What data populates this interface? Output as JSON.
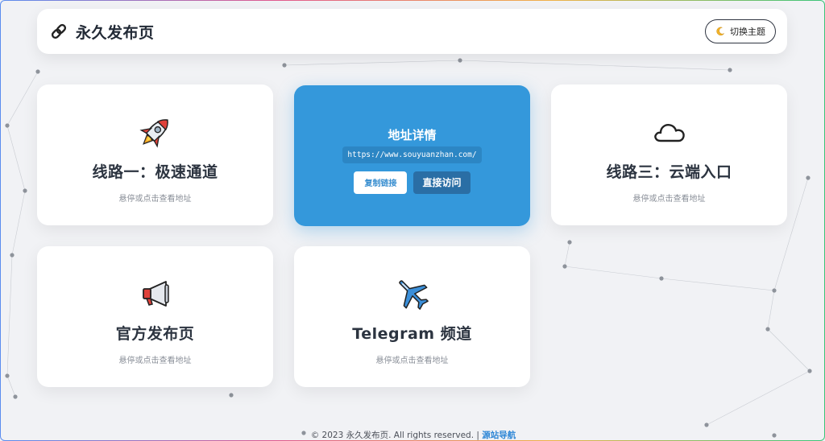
{
  "header": {
    "title": "永久发布页",
    "theme_button": "切换主题",
    "brand_icon": "link-icon",
    "theme_icon": "moon-icon"
  },
  "cards": [
    {
      "title": "线路一：极速通道",
      "hint": "悬停或点击查看地址",
      "icon": "rocket-icon"
    },
    {
      "detail_title": "地址详情",
      "url": "https://www.souyuanzhan.com/",
      "copy_label": "复制链接",
      "visit_label": "直接访问"
    },
    {
      "title": "线路三：云端入口",
      "hint": "悬停或点击查看地址",
      "icon": "cloud-icon"
    },
    {
      "title": "官方发布页",
      "hint": "悬停或点击查看地址",
      "icon": "megaphone-icon"
    },
    {
      "title": "Telegram 频道",
      "hint": "悬停或点击查看地址",
      "icon": "airplane-icon"
    }
  ],
  "footer": {
    "copyright": "© 2023 永久发布页. All rights reserved. |",
    "link": "源站导航"
  },
  "colors": {
    "accent": "#3498db",
    "background": "#f1f2f5",
    "card": "#ffffff"
  }
}
